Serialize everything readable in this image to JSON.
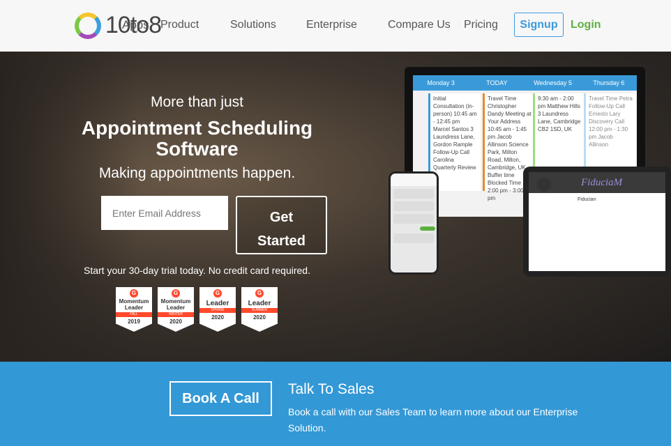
{
  "nav": {
    "logo": "10to8",
    "apps": "Apps",
    "links": [
      "Product",
      "Solutions",
      "Enterprise",
      "Compare Us",
      "Pricing"
    ],
    "signup": "Signup",
    "login": "Login"
  },
  "hero": {
    "pre": "More than just",
    "title1": "Appointment Scheduling",
    "title2": "Software",
    "tagline": "Making appointments happen.",
    "email_placeholder": "Enter Email Address",
    "cta1": "Get",
    "cta2": "Started",
    "trial": "Start your 30-day trial today. No credit card required.",
    "badges": [
      {
        "title1": "Momentum",
        "title2": "Leader",
        "season": "FALL",
        "year": "2019"
      },
      {
        "title1": "Momentum",
        "title2": "Leader",
        "season": "WINTER",
        "year": "2020"
      },
      {
        "title1": "",
        "title2": "Leader",
        "season": "SPRING",
        "year": "2020"
      },
      {
        "title1": "",
        "title2": "Leader",
        "season": "SUMMER",
        "year": "2020"
      }
    ]
  },
  "mockup": {
    "days": [
      "Monday 3",
      "TODAY",
      "Wednesday 5",
      "Thursday 6"
    ],
    "cols": [
      "Initial Consultation (in-person) 10:45 am - 12:45 pm Marcel Santos 3 Laundress Lane, Gordon Rample Follow-Up Call Carolina Quarterly Review",
      "Travel Time Christopher Dandy Meeting at Your Address 10:45 am - 1:45 pm Jacob Allinson Science Park, Milton Road, Milton, Cambridge, UK Buffer time Blocked Time 2:00 pm - 3:00 pm",
      "9:30 am - 2:00 pm Matthew Hills 3 Laundress Lane, Cambridge CB2 1SD, UK",
      "Travel Time Petra Follow-Up Call Ernesto Lary Discovery Call 12:00 pm - 1:30 pm Jacob Allinson"
    ],
    "tablet_brand": "FiduciaM",
    "tablet_heading": "Fiducian"
  },
  "cta": {
    "button": "Book A Call",
    "title": "Talk To Sales",
    "desc": "Book a call with our Sales Team to learn more about our Enterprise Solution."
  },
  "colors": {
    "brand_blue": "#3398d6",
    "login_green": "#5cb040",
    "g2_red": "#ff492c"
  }
}
